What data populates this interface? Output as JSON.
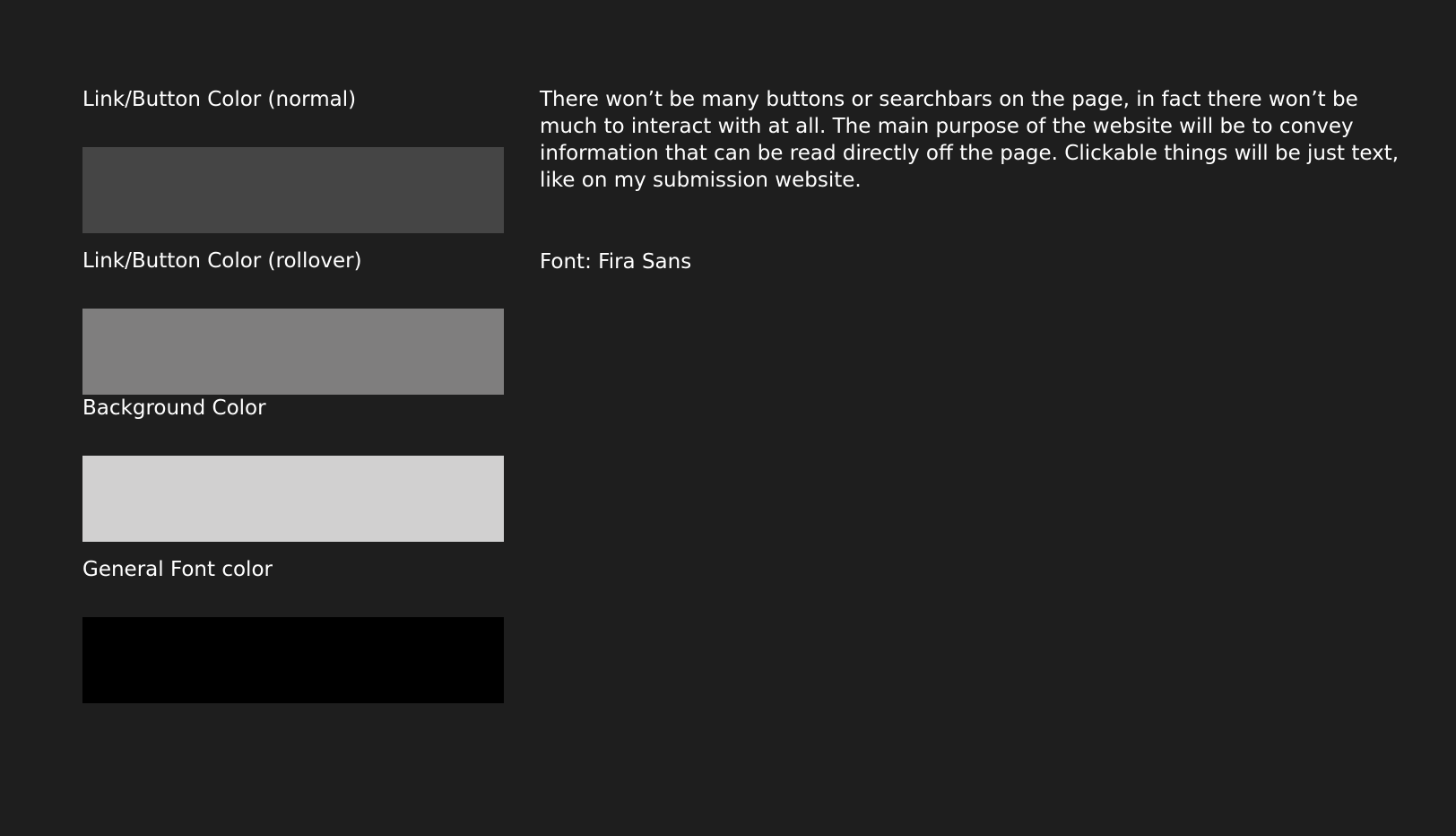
{
  "swatches": [
    {
      "label": "Link/Button Color (normal)",
      "color": "#454545"
    },
    {
      "label": "Link/Button Color (rollover)",
      "color": "#7f7e7e"
    },
    {
      "label": "Background Color",
      "color": "#d1d0d0"
    },
    {
      "label": "General Font color",
      "color": "#000000"
    }
  ],
  "notes": {
    "description": "There won’t be many buttons or searchbars on the page, in fact there won’t be much to interact with at all.  The main purpose of the website will be to convey information that can be read directly off the page.  Clickable things will be just text, like on my submission website.",
    "font": "Font: Fira Sans"
  },
  "theme": {
    "canvas_background": "#1e1e1e",
    "text_color": "#ffffff"
  }
}
